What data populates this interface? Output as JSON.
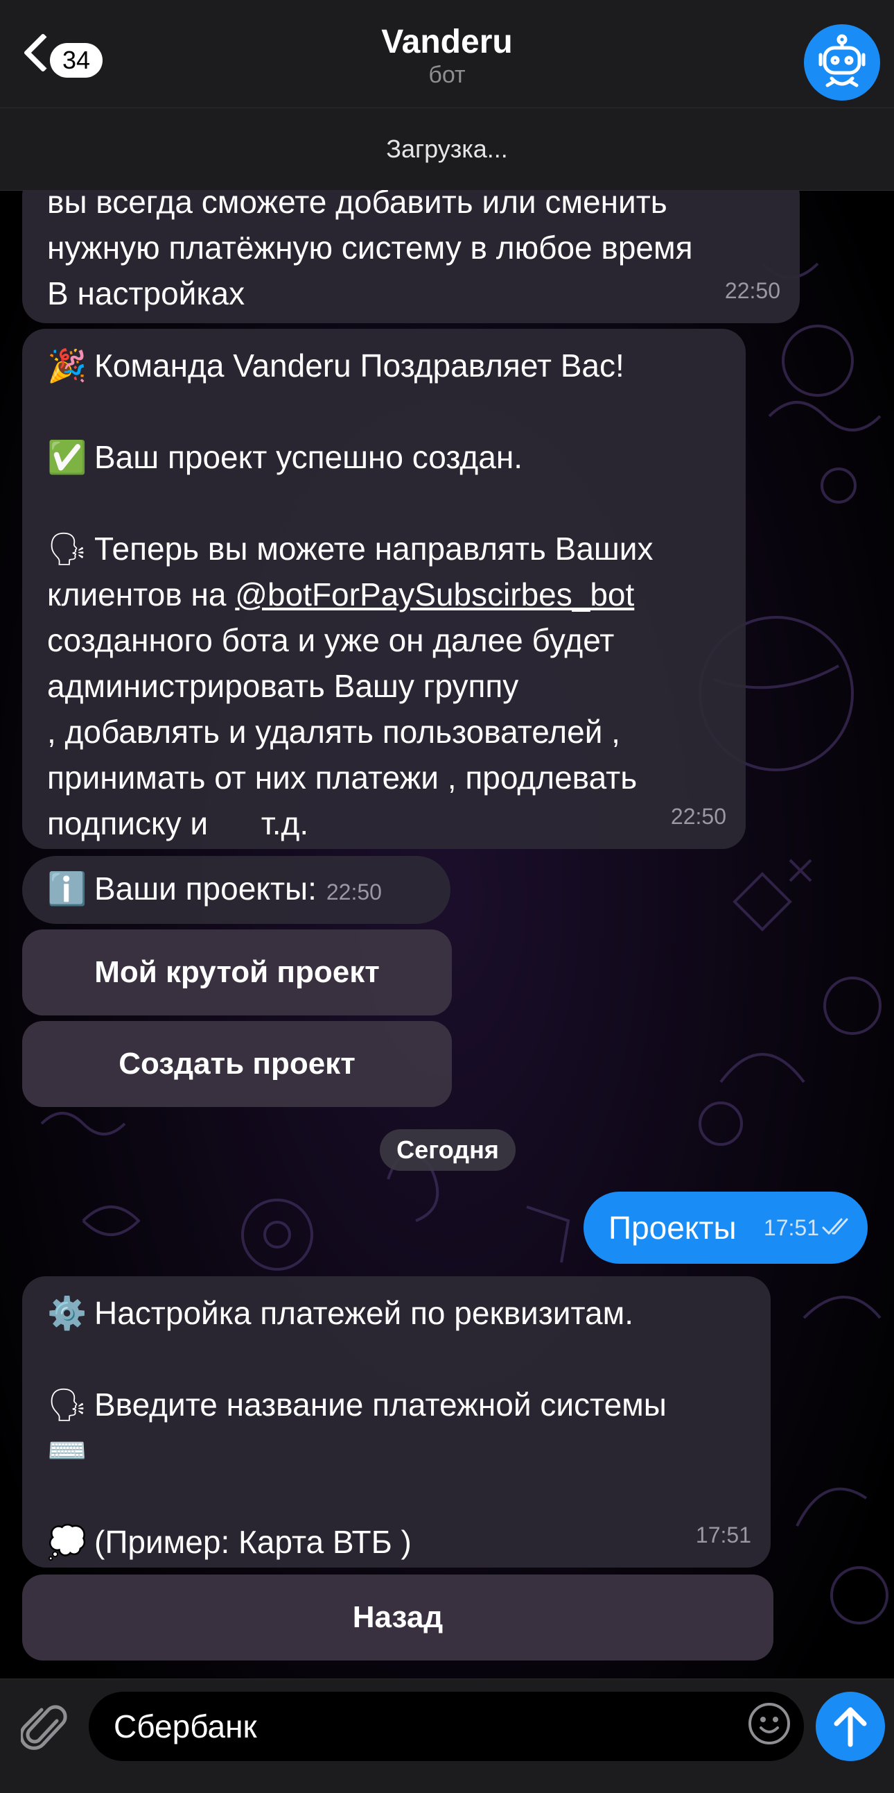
{
  "header": {
    "back_count": "34",
    "title": "Vanderu",
    "subtitle": "бот",
    "status": "Загрузка..."
  },
  "messages": {
    "m1": {
      "lines": [
        "вы всегда сможете добавить или сменить",
        "нужную платёжную систему в любое время",
        "В настройках"
      ],
      "time": "22:50"
    },
    "m2": {
      "line1_emoji": "🎉",
      "line1": "Команда Vanderu Поздравляет Вас!",
      "line2_emoji": "✅",
      "line2": "Ваш проект успешно создан.",
      "line3_emoji": "🗣",
      "line3": "Теперь вы можете направлять Ваших",
      "line4_prefix": "клиентов на ",
      "line4_link": "@botForPaySubscirbes_bot",
      "line5": "созданного бота и уже он далее будет",
      "line6": "администрировать Вашу группу",
      "line7": ", добавлять и удалять пользователей ,",
      "line8": "принимать от них платежи , продлевать",
      "line9": "подписку и      т.д.",
      "time": "22:50"
    },
    "m3": {
      "emoji": "ℹ️",
      "text": "Ваши проекты:",
      "time": "22:50"
    },
    "kb1": [
      "Мой крутой проект",
      "Создать проект"
    ],
    "date_separator": "Сегодня",
    "outgoing": {
      "text": "Проекты",
      "time": "17:51"
    },
    "m4": {
      "line1_emoji": "⚙️",
      "line1": "Настройка платежей по реквизитам.",
      "line2_emoji": "🗣",
      "line2": "Введите название платежной системы",
      "line3_emoji": "⌨️",
      "line4_emoji": "💭",
      "line4": "(Пример: Карта ВТБ )",
      "time": "17:51"
    },
    "kb2": [
      "Назад"
    ]
  },
  "input": {
    "value": "Сбербанк"
  },
  "colors": {
    "accent": "#1a8cf6",
    "bubble_in": "#2c2834",
    "bar": "#1c1c1e"
  }
}
